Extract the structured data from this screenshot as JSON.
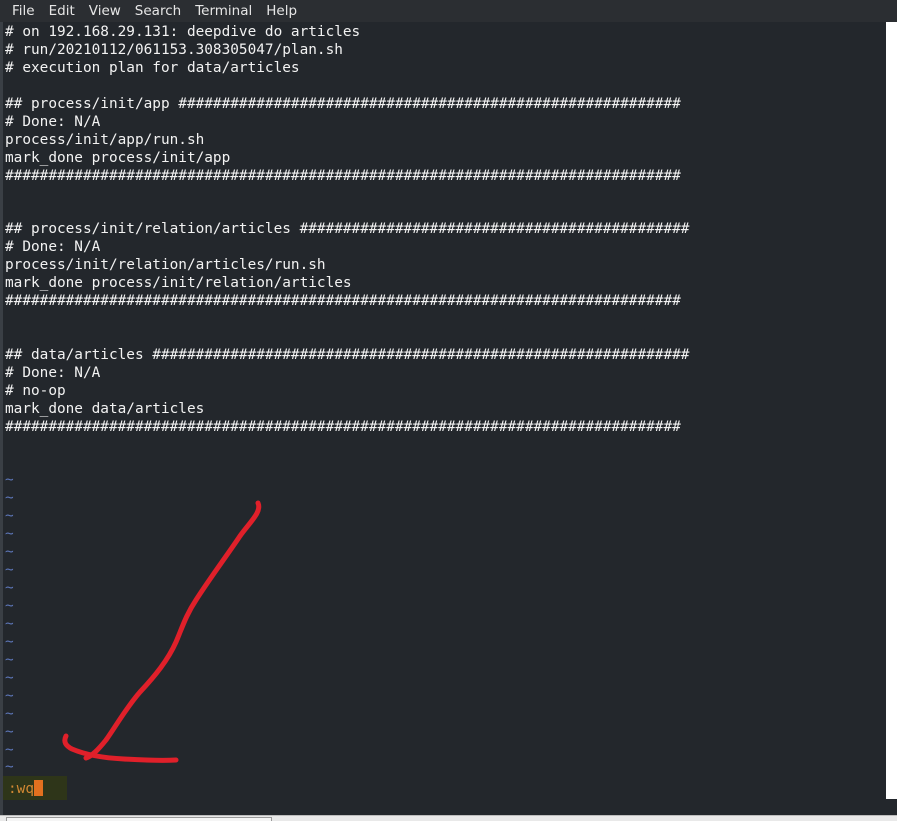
{
  "menu": [
    "File",
    "Edit",
    "View",
    "Search",
    "Terminal",
    "Help"
  ],
  "lines": [
    "# on 192.168.29.131: deepdive do articles",
    "# run/20210112/061153.308305047/plan.sh",
    "# execution plan for data/articles",
    "",
    "## process/init/app ##########################################################",
    "# Done: N/A",
    "process/init/app/run.sh",
    "mark_done process/init/app",
    "##############################################################################",
    "",
    "",
    "## process/init/relation/articles #############################################",
    "# Done: N/A",
    "process/init/relation/articles/run.sh",
    "mark_done process/init/relation/articles",
    "##############################################################################",
    "",
    "",
    "## data/articles ##############################################################",
    "# Done: N/A",
    "# no-op",
    "mark_done data/articles",
    "##############################################################################",
    "",
    "",
    "~",
    "~",
    "~",
    "~",
    "~",
    "~",
    "~",
    "~",
    "~",
    "~",
    "~",
    "~",
    "~",
    "~",
    "~",
    "~",
    "~"
  ],
  "command": ":wq",
  "colors": {
    "background": "#23272c",
    "text": "#f2f2f2",
    "tilde": "#5d76b8",
    "command": "#d28833",
    "annotation": "#e0202a"
  }
}
